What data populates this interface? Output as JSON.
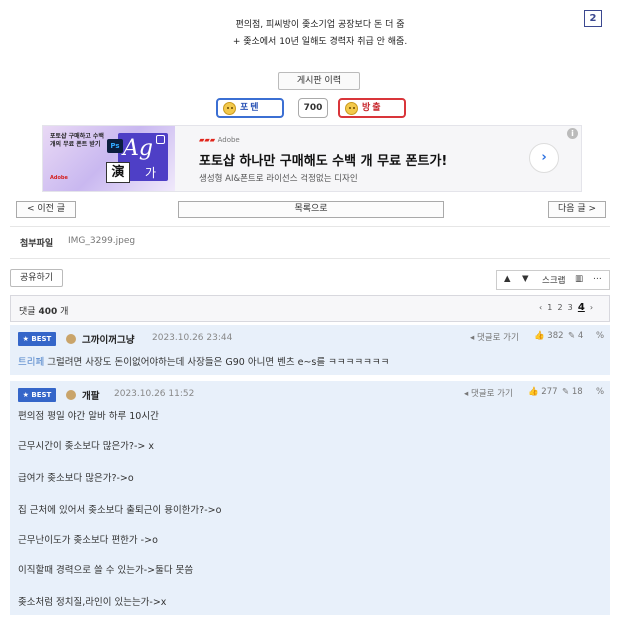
{
  "page_number": "2",
  "post": {
    "caption_line1": "편의점, 피씨방이 좆소기업 공장보다 돈 더 줌",
    "caption_line2": "+ 좆소에서 10년 일해도 경력자 취급 안 해줌."
  },
  "history_button": "게시판 이력",
  "recommend": {
    "up_label": "포텐",
    "count": "700",
    "down_label": "방출"
  },
  "ad": {
    "image_text": "포토샵 구매하고 수백 개의 무료 폰트 받기",
    "image_brand": "Adobe",
    "image_ps": "Ps",
    "image_ag": "Ag",
    "image_han": "演",
    "image_ga": "가",
    "brand": "Adobe",
    "headline": "포토샵 하나만 구매해도 수백 개 무료 폰트가!",
    "subtext": "생성형 AI&폰트로 라이선스 걱정없는 디자인",
    "arrow": "›",
    "info": "i"
  },
  "nav": {
    "prev": "< 이전 글",
    "list": "목록으로",
    "next": "다음 글 >"
  },
  "attachment": {
    "label": "첨부파일",
    "filename": "IMG_3299.jpeg"
  },
  "share_button": "공유하기",
  "tools": {
    "up": "▲",
    "down": "▼",
    "scrap": "스크랩",
    "chart": "▥",
    "more": "⋯"
  },
  "comments_header": {
    "prefix": "댓글",
    "count": "400",
    "suffix": "개"
  },
  "pagination": {
    "prev": "‹",
    "pages": [
      "1",
      "2",
      "3"
    ],
    "current": "4",
    "next": "›"
  },
  "comments": [
    {
      "badge": "BEST",
      "nick": "그까이꺼그냥",
      "date": "2023.10.26 23:44",
      "reply": "댓글로 가기",
      "likes": "382",
      "dislikes": "4",
      "prefix": "트리페",
      "body": "그럴려면 사장도 돈이없어야하는데 사장들은 G90 아니면 벤츠 e~s를 ㅋㅋㅋㅋㅋㅋㅋ"
    },
    {
      "badge": "BEST",
      "nick": "개팔",
      "date": "2023.10.26 11:52",
      "reply": "댓글로 가기",
      "likes": "277",
      "dislikes": "18",
      "lines": [
        "편의점 평일 야간 알바 하루 10시간",
        "근무시간이 좆소보다 많은가?-> x",
        "급여가 좆소보다 많은가?->o",
        "집 근처에 있어서 좆소보다 출퇴근이 용이한가?->o",
        "근무난이도가 좆소보다 편한가 ->o",
        "이직할때 경력으로 쓸 수 있는가->둘다 못씀",
        "좆소처럼 정치질,라인이 있는는가->x"
      ]
    }
  ]
}
